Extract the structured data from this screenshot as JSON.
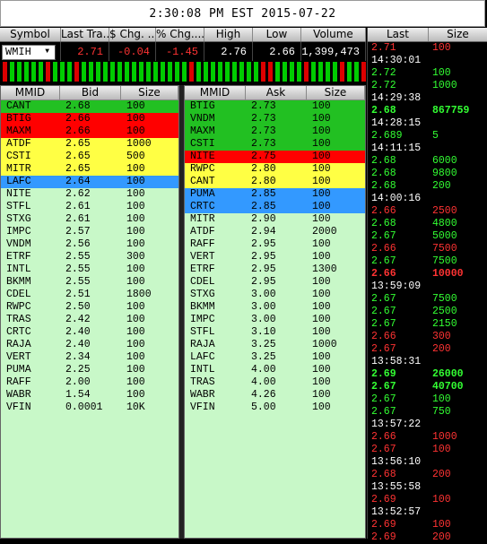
{
  "title": "2:30:08 PM EST 2015-07-22",
  "quote": {
    "headers": [
      "Symbol",
      "Last Tra...",
      "$ Chg. ...",
      "% Chg....",
      "High",
      "Low",
      "Volume"
    ],
    "symbol": "WMIH",
    "last": "2.71",
    "chg": "-0.04",
    "pct": "-1.45",
    "high": "2.76",
    "low": "2.66",
    "volume": "1,399,473"
  },
  "tick_colors": [
    "#d00",
    "#0c0",
    "#0c0",
    "#0c0",
    "#0c0",
    "#0c0",
    "#d00",
    "#0c0",
    "#0c0",
    "#0c0",
    "#d00",
    "#0c0",
    "#0c0",
    "#0c0",
    "#0c0",
    "#0c0",
    "#0c0",
    "#0c0",
    "#0c0",
    "#0c0",
    "#0c0",
    "#0c0",
    "#0c0",
    "#0c0",
    "#0c0",
    "#0c0",
    "#d00",
    "#0c0",
    "#0c0",
    "#0c0",
    "#0c0",
    "#0c0",
    "#0c0",
    "#0c0",
    "#0c0",
    "#0c0",
    "#d00",
    "#d00",
    "#0c0",
    "#0c0",
    "#0c0",
    "#0c0",
    "#d00",
    "#0c0",
    "#0c0",
    "#0c0",
    "#0c0",
    "#d00",
    "#0c0",
    "#0c0",
    "#d00"
  ],
  "bid": {
    "headers": [
      "MMID",
      "Bid",
      "Size"
    ],
    "rows": [
      {
        "mmid": "CANT",
        "price": "2.68",
        "size": "100",
        "bg": "#22c022"
      },
      {
        "mmid": "BTIG",
        "price": "2.66",
        "size": "100",
        "bg": "#ff0000"
      },
      {
        "mmid": "MAXM",
        "price": "2.66",
        "size": "100",
        "bg": "#ff0000"
      },
      {
        "mmid": "ATDF",
        "price": "2.65",
        "size": "1000",
        "bg": "#ffff44"
      },
      {
        "mmid": "CSTI",
        "price": "2.65",
        "size": "500",
        "bg": "#ffff44"
      },
      {
        "mmid": "MITR",
        "price": "2.65",
        "size": "100",
        "bg": "#ffff44"
      },
      {
        "mmid": "LAFC",
        "price": "2.64",
        "size": "100",
        "bg": "#3399ff"
      },
      {
        "mmid": "NITE",
        "price": "2.62",
        "size": "100",
        "bg": ""
      },
      {
        "mmid": "STFL",
        "price": "2.61",
        "size": "100",
        "bg": ""
      },
      {
        "mmid": "STXG",
        "price": "2.61",
        "size": "100",
        "bg": ""
      },
      {
        "mmid": "IMPC",
        "price": "2.57",
        "size": "100",
        "bg": ""
      },
      {
        "mmid": "VNDM",
        "price": "2.56",
        "size": "100",
        "bg": ""
      },
      {
        "mmid": "ETRF",
        "price": "2.55",
        "size": "300",
        "bg": ""
      },
      {
        "mmid": "INTL",
        "price": "2.55",
        "size": "100",
        "bg": ""
      },
      {
        "mmid": "BKMM",
        "price": "2.55",
        "size": "100",
        "bg": ""
      },
      {
        "mmid": "CDEL",
        "price": "2.51",
        "size": "1800",
        "bg": ""
      },
      {
        "mmid": "RWPC",
        "price": "2.50",
        "size": "100",
        "bg": ""
      },
      {
        "mmid": "TRAS",
        "price": "2.42",
        "size": "100",
        "bg": ""
      },
      {
        "mmid": "CRTC",
        "price": "2.40",
        "size": "100",
        "bg": ""
      },
      {
        "mmid": "RAJA",
        "price": "2.40",
        "size": "100",
        "bg": ""
      },
      {
        "mmid": "VERT",
        "price": "2.34",
        "size": "100",
        "bg": ""
      },
      {
        "mmid": "PUMA",
        "price": "2.25",
        "size": "100",
        "bg": ""
      },
      {
        "mmid": "RAFF",
        "price": "2.00",
        "size": "100",
        "bg": ""
      },
      {
        "mmid": "WABR",
        "price": "1.54",
        "size": "100",
        "bg": ""
      },
      {
        "mmid": "VFIN",
        "price": "0.0001",
        "size": "10K",
        "bg": ""
      }
    ]
  },
  "ask": {
    "headers": [
      "MMID",
      "Ask",
      "Size"
    ],
    "rows": [
      {
        "mmid": "BTIG",
        "price": "2.73",
        "size": "100",
        "bg": "#22c022"
      },
      {
        "mmid": "VNDM",
        "price": "2.73",
        "size": "100",
        "bg": "#22c022"
      },
      {
        "mmid": "MAXM",
        "price": "2.73",
        "size": "100",
        "bg": "#22c022"
      },
      {
        "mmid": "CSTI",
        "price": "2.73",
        "size": "100",
        "bg": "#22c022"
      },
      {
        "mmid": "NITE",
        "price": "2.75",
        "size": "100",
        "bg": "#ff0000"
      },
      {
        "mmid": "RWPC",
        "price": "2.80",
        "size": "100",
        "bg": "#ffff44"
      },
      {
        "mmid": "CANT",
        "price": "2.80",
        "size": "100",
        "bg": "#ffff44"
      },
      {
        "mmid": "PUMA",
        "price": "2.85",
        "size": "100",
        "bg": "#3399ff"
      },
      {
        "mmid": "CRTC",
        "price": "2.85",
        "size": "100",
        "bg": "#3399ff"
      },
      {
        "mmid": "MITR",
        "price": "2.90",
        "size": "100",
        "bg": ""
      },
      {
        "mmid": "ATDF",
        "price": "2.94",
        "size": "2000",
        "bg": ""
      },
      {
        "mmid": "RAFF",
        "price": "2.95",
        "size": "100",
        "bg": ""
      },
      {
        "mmid": "VERT",
        "price": "2.95",
        "size": "100",
        "bg": ""
      },
      {
        "mmid": "ETRF",
        "price": "2.95",
        "size": "1300",
        "bg": ""
      },
      {
        "mmid": "CDEL",
        "price": "2.95",
        "size": "100",
        "bg": ""
      },
      {
        "mmid": "STXG",
        "price": "3.00",
        "size": "100",
        "bg": ""
      },
      {
        "mmid": "BKMM",
        "price": "3.00",
        "size": "100",
        "bg": ""
      },
      {
        "mmid": "IMPC",
        "price": "3.00",
        "size": "100",
        "bg": ""
      },
      {
        "mmid": "STFL",
        "price": "3.10",
        "size": "100",
        "bg": ""
      },
      {
        "mmid": "RAJA",
        "price": "3.25",
        "size": "1000",
        "bg": ""
      },
      {
        "mmid": "LAFC",
        "price": "3.25",
        "size": "100",
        "bg": ""
      },
      {
        "mmid": "INTL",
        "price": "4.00",
        "size": "100",
        "bg": ""
      },
      {
        "mmid": "TRAS",
        "price": "4.00",
        "size": "100",
        "bg": ""
      },
      {
        "mmid": "WABR",
        "price": "4.26",
        "size": "100",
        "bg": ""
      },
      {
        "mmid": "VFIN",
        "price": "5.00",
        "size": "100",
        "bg": ""
      }
    ]
  },
  "tape": {
    "headers": [
      "Last",
      "Size"
    ],
    "rows": [
      {
        "type": "trade",
        "price": "2.71",
        "size": "100",
        "color": "#ff3333",
        "bold": false
      },
      {
        "type": "time",
        "time": "14:30:01"
      },
      {
        "type": "trade",
        "price": "2.72",
        "size": "100",
        "color": "#33ff33",
        "bold": false
      },
      {
        "type": "trade",
        "price": "2.72",
        "size": "1000",
        "color": "#33ff33",
        "bold": false
      },
      {
        "type": "time",
        "time": "14:29:38"
      },
      {
        "type": "trade",
        "price": "2.68",
        "size": "867759",
        "color": "#33ff33",
        "bold": true
      },
      {
        "type": "time",
        "time": "14:28:15"
      },
      {
        "type": "trade",
        "price": "2.689",
        "size": "5",
        "color": "#33ff33",
        "bold": false
      },
      {
        "type": "time",
        "time": "14:11:15"
      },
      {
        "type": "trade",
        "price": "2.68",
        "size": "6000",
        "color": "#33ff33",
        "bold": false
      },
      {
        "type": "trade",
        "price": "2.68",
        "size": "9800",
        "color": "#33ff33",
        "bold": false
      },
      {
        "type": "trade",
        "price": "2.68",
        "size": "200",
        "color": "#33ff33",
        "bold": false
      },
      {
        "type": "time",
        "time": "14:00:16"
      },
      {
        "type": "trade",
        "price": "2.66",
        "size": "2500",
        "color": "#ff3333",
        "bold": false
      },
      {
        "type": "trade",
        "price": "2.68",
        "size": "4800",
        "color": "#33ff33",
        "bold": false
      },
      {
        "type": "trade",
        "price": "2.67",
        "size": "5000",
        "color": "#33ff33",
        "bold": false
      },
      {
        "type": "trade",
        "price": "2.66",
        "size": "7500",
        "color": "#ff3333",
        "bold": false
      },
      {
        "type": "trade",
        "price": "2.67",
        "size": "7500",
        "color": "#33ff33",
        "bold": false
      },
      {
        "type": "trade",
        "price": "2.66",
        "size": "10000",
        "color": "#ff3333",
        "bold": true
      },
      {
        "type": "time",
        "time": "13:59:09"
      },
      {
        "type": "trade",
        "price": "2.67",
        "size": "7500",
        "color": "#33ff33",
        "bold": false
      },
      {
        "type": "trade",
        "price": "2.67",
        "size": "2500",
        "color": "#33ff33",
        "bold": false
      },
      {
        "type": "trade",
        "price": "2.67",
        "size": "2150",
        "color": "#33ff33",
        "bold": false
      },
      {
        "type": "trade",
        "price": "2.66",
        "size": "300",
        "color": "#ff3333",
        "bold": false
      },
      {
        "type": "trade",
        "price": "2.67",
        "size": "200",
        "color": "#ff3333",
        "bold": false
      },
      {
        "type": "time",
        "time": "13:58:31"
      },
      {
        "type": "trade",
        "price": "2.69",
        "size": "26000",
        "color": "#33ff33",
        "bold": true
      },
      {
        "type": "trade",
        "price": "2.67",
        "size": "40700",
        "color": "#33ff33",
        "bold": true
      },
      {
        "type": "trade",
        "price": "2.67",
        "size": "100",
        "color": "#33ff33",
        "bold": false
      },
      {
        "type": "trade",
        "price": "2.67",
        "size": "750",
        "color": "#33ff33",
        "bold": false
      },
      {
        "type": "time",
        "time": "13:57:22"
      },
      {
        "type": "trade",
        "price": "2.66",
        "size": "1000",
        "color": "#ff3333",
        "bold": false
      },
      {
        "type": "trade",
        "price": "2.67",
        "size": "100",
        "color": "#ff3333",
        "bold": false
      },
      {
        "type": "time",
        "time": "13:56:10"
      },
      {
        "type": "trade",
        "price": "2.68",
        "size": "200",
        "color": "#ff3333",
        "bold": false
      },
      {
        "type": "time",
        "time": "13:55:58"
      },
      {
        "type": "trade",
        "price": "2.69",
        "size": "100",
        "color": "#ff3333",
        "bold": false
      },
      {
        "type": "time",
        "time": "13:52:57"
      },
      {
        "type": "trade",
        "price": "2.69",
        "size": "100",
        "color": "#ff3333",
        "bold": false
      },
      {
        "type": "trade",
        "price": "2.69",
        "size": "200",
        "color": "#ff3333",
        "bold": false
      }
    ]
  }
}
